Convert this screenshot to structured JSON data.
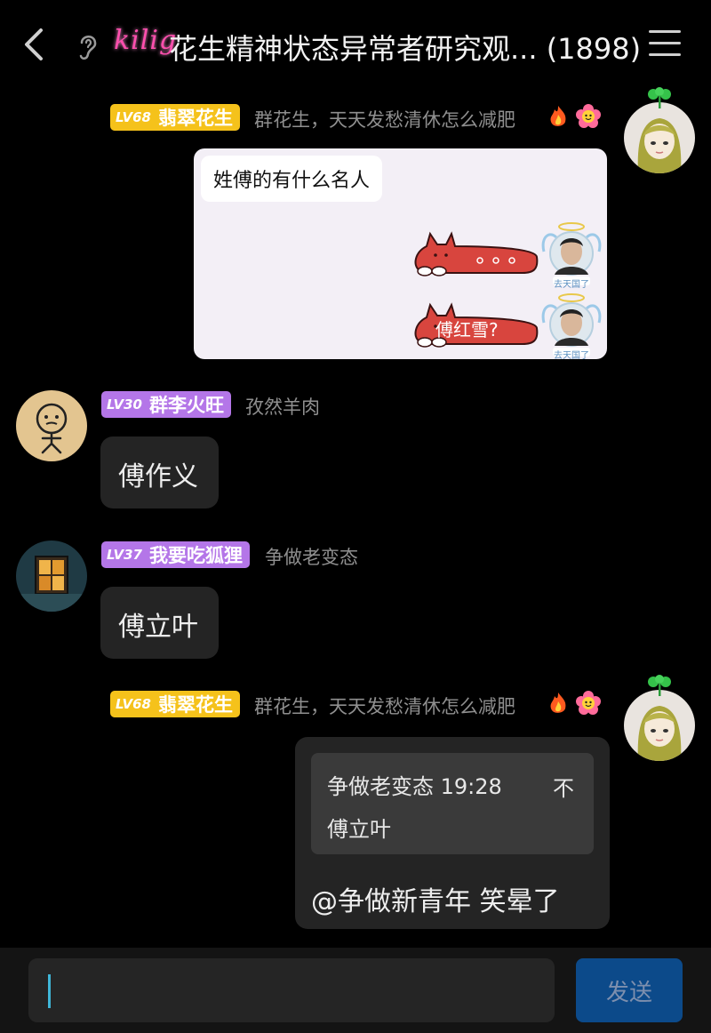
{
  "header": {
    "brand": "kilig",
    "title": "花生精神状态异常者研究观... (1898)"
  },
  "messages": [
    {
      "badge_level": "LV68",
      "badge_name": "翡翠花生",
      "title": "群花生，天天发愁清休怎么减肥",
      "screenshot": {
        "text": "姓傅的有什么名人",
        "cat1_text": "",
        "cat2_text": "傅红雪?",
        "mini_avatar_label": "去天国了"
      }
    },
    {
      "badge_level": "LV30",
      "badge_name": "群李火旺",
      "title": "孜然羊肉",
      "text": "傅作义"
    },
    {
      "badge_level": "LV37",
      "badge_name": "我要吃狐狸",
      "title": "争做老变态",
      "text": "傅立叶"
    },
    {
      "badge_level": "LV68",
      "badge_name": "翡翠花生",
      "title": "群花生，天天发愁清休怎么减肥",
      "quote": {
        "meta": "争做老变态 19:28",
        "text": "傅立叶",
        "icon": "不"
      },
      "text": "@争做新青年 笑晕了"
    }
  ],
  "input": {
    "placeholder": "",
    "send_label": "发送"
  },
  "colors": {
    "gold_badge": "#f5c21b",
    "purple_badge": "#b476e8",
    "accent_pink": "#ff4fae",
    "send_button": "#0c4a8a"
  }
}
